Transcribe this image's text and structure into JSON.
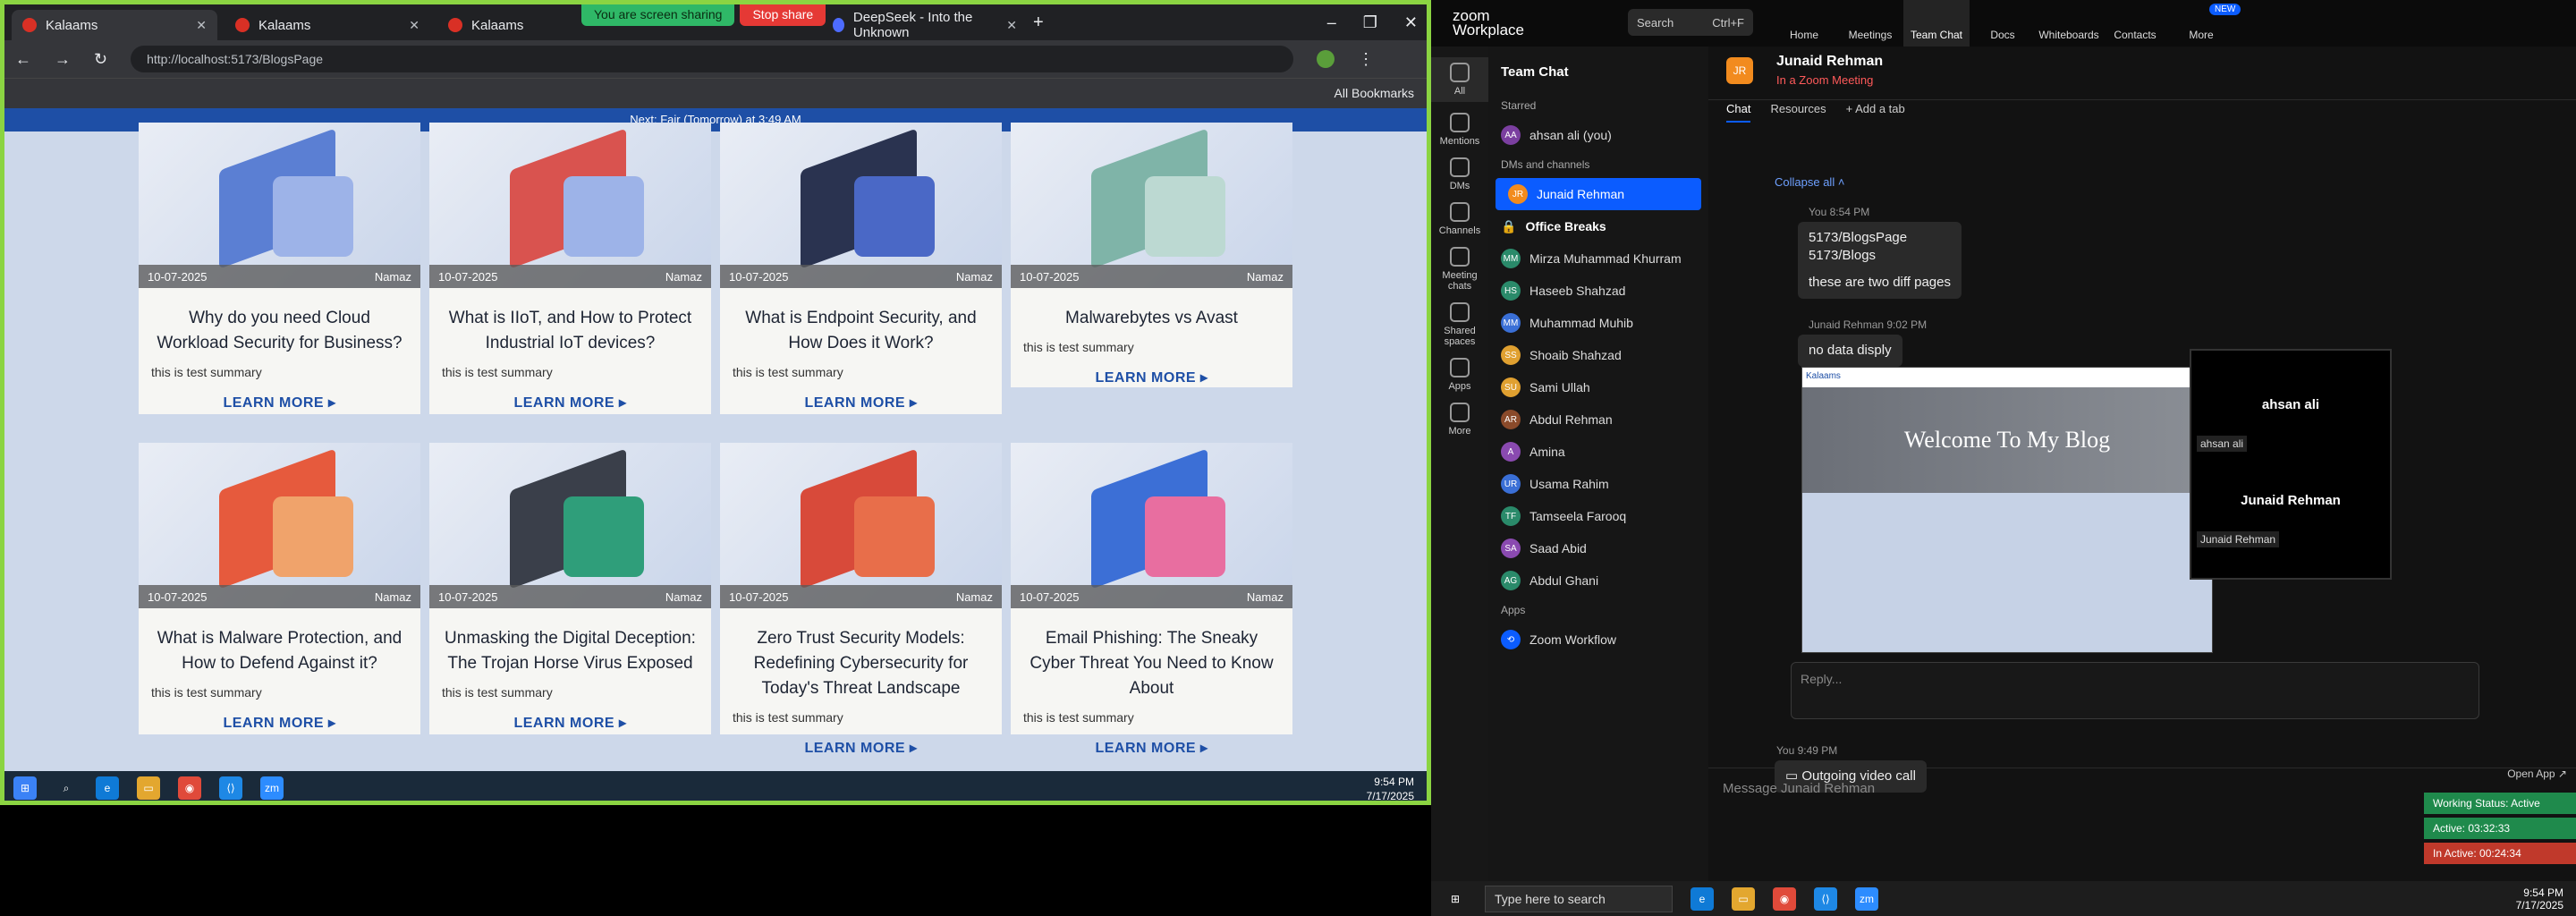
{
  "browser": {
    "tabs": [
      {
        "label": "Kalaams"
      },
      {
        "label": "Kalaams"
      },
      {
        "label": "Kalaams"
      },
      {
        "label": "DeepSeek - Into the Unknown"
      }
    ],
    "sharing": "You are screen sharing",
    "stop": "Stop share",
    "url": "http://localhost:5173/BlogsPage",
    "bookmarks": "All Bookmarks"
  },
  "site": {
    "prayer": "Next: Fajr (Tomorrow) at 3:49 AM"
  },
  "posts": [
    {
      "date": "10-07-2025",
      "author": "Namaz",
      "title": "Why do you need Cloud Workload Security for Business?",
      "summary": "this is test summary",
      "cta": "LEARN MORE ▸"
    },
    {
      "date": "10-07-2025",
      "author": "Namaz",
      "title": "What is IIoT, and How to Protect Industrial IoT devices?",
      "summary": "this is test summary",
      "cta": "LEARN MORE ▸"
    },
    {
      "date": "10-07-2025",
      "author": "Namaz",
      "title": "What is Endpoint Security, and How Does it Work?",
      "summary": "this is test summary",
      "cta": "LEARN MORE ▸"
    },
    {
      "date": "10-07-2025",
      "author": "Namaz",
      "title": "Malwarebytes vs Avast",
      "summary": "this is test summary",
      "cta": "LEARN MORE ▸"
    },
    {
      "date": "10-07-2025",
      "author": "Namaz",
      "title": "What is Malware Protection, and How to Defend Against it?",
      "summary": "this is test summary",
      "cta": "LEARN MORE ▸"
    },
    {
      "date": "10-07-2025",
      "author": "Namaz",
      "title": "Unmasking the Digital Deception: The Trojan Horse Virus Exposed",
      "summary": "this is test summary",
      "cta": "LEARN MORE ▸"
    },
    {
      "date": "10-07-2025",
      "author": "Namaz",
      "title": "Zero Trust Security Models: Redefining Cybersecurity for Today's Threat Landscape",
      "summary": "this is test summary",
      "cta": "LEARN MORE ▸"
    },
    {
      "date": "10-07-2025",
      "author": "Namaz",
      "title": "Email Phishing: The Sneaky Cyber Threat You Need to Know About",
      "summary": "this is test summary",
      "cta": "LEARN MORE ▸"
    }
  ],
  "taskbar_left": {
    "time": "9:54 PM",
    "date": "7/17/2025"
  },
  "zoom": {
    "brand_line1": "zoom",
    "brand_line2": "Workplace",
    "search": "Search",
    "search_shortcut": "Ctrl+F",
    "nav": [
      "Home",
      "Meetings",
      "Team Chat",
      "Docs",
      "Whiteboards",
      "Contacts",
      "More"
    ],
    "new_badge": "NEW",
    "rail": [
      "All",
      "Mentions",
      "DMs",
      "Channels",
      "Meeting chats",
      "Shared spaces",
      "Apps",
      "More"
    ],
    "list_title": "Team Chat",
    "sec_starred": "Starred",
    "starred": [
      "ahsan ali (you)"
    ],
    "sec_dms": "DMs and channels",
    "dms": [
      "Junaid Rehman",
      "Office Breaks",
      "Mirza Muhammad Khurram",
      "Haseeb Shahzad",
      "Muhammad Muhib",
      "Shoaib Shahzad",
      "Sami Ullah",
      "Abdul Rehman",
      "Amina",
      "Usama Rahim",
      "Tamseela Farooq",
      "Saad Abid",
      "Abdul Ghani"
    ],
    "sec_apps": "Apps",
    "apps": [
      "Zoom Workflow"
    ],
    "chat_name": "Junaid Rehman",
    "chat_status": "In a Zoom Meeting",
    "tab_chat": "Chat",
    "tab_res": "Resources",
    "tab_add": "+ Add a tab",
    "collapse": "Collapse all ˄",
    "msg1_meta": "You 8:54 PM",
    "msg1_l1": "5173/BlogsPage",
    "msg1_l2": "5173/Blogs",
    "msg1_l3": "these are two diff pages",
    "msg2_meta": "Junaid Rehman 9:02 PM",
    "msg2": "no data disply",
    "shot_brand": "Kalaams",
    "shot_title": "Welcome To My Blog",
    "pop_name1": "ahsan ali",
    "pop_label1": "ahsan ali",
    "pop_name2": "Junaid Rehman",
    "pop_label2": "Junaid Rehman",
    "reply_ph": "Reply...",
    "msg3_meta": "You 9:49 PM",
    "msg3": "Outgoing video call",
    "compose_ph": "Message Junaid Rehman",
    "open_app": "Open App ↗",
    "working": "Working Status: Active",
    "active": "Active: 03:32:33",
    "inactive": "In Active: 00:24:34"
  },
  "taskbar_right": {
    "search": "Type here to search",
    "time": "9:54 PM",
    "date": "7/17/2025"
  }
}
